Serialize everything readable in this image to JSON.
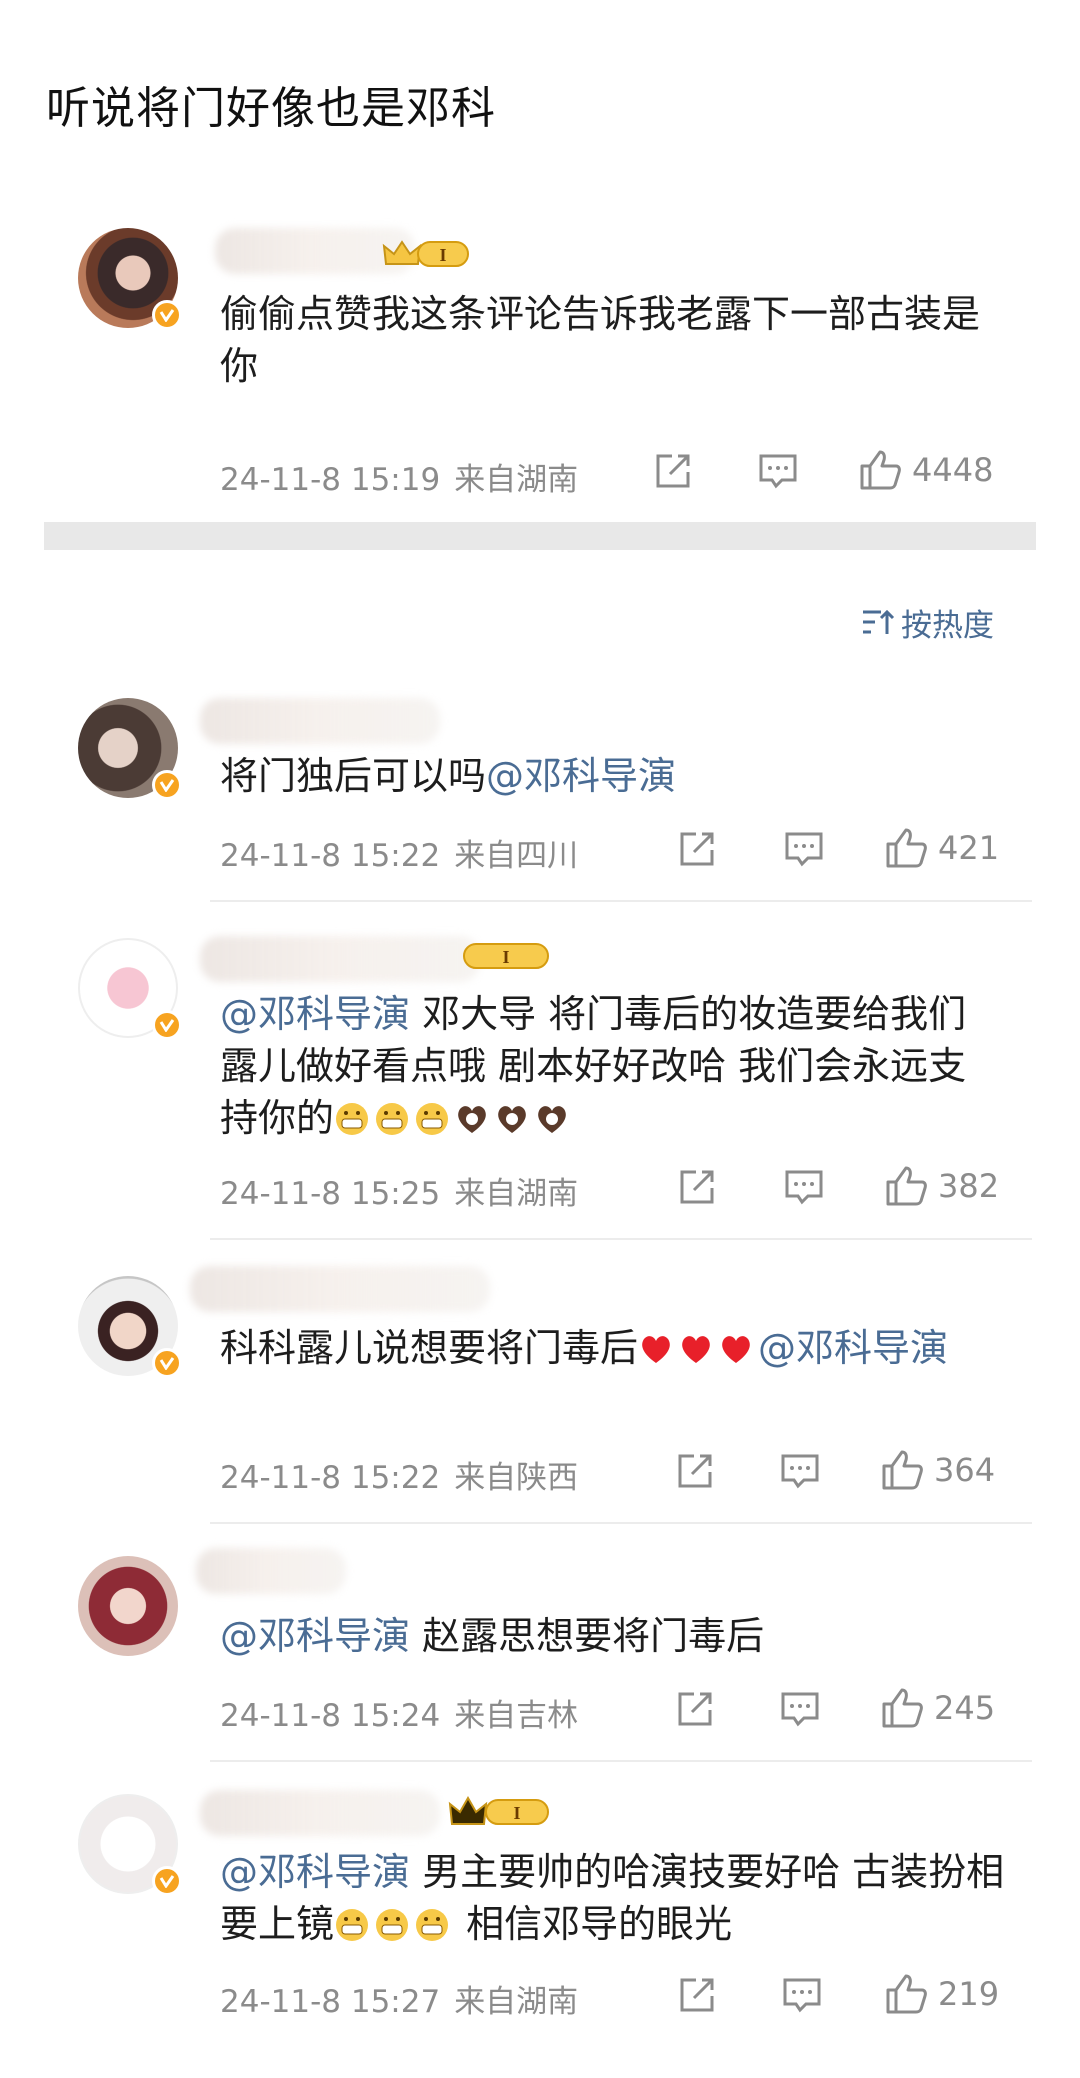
{
  "page": {
    "title": "听说将门好像也是邓科"
  },
  "sort": {
    "label": "按热度"
  },
  "top_comment": {
    "text": "偷偷点赞我这条评论告诉我老露下一部古装是你",
    "time": "24-11-8 15:19",
    "location": "来自湖南",
    "likes": "4448"
  },
  "replies": [
    {
      "pre": "将门独后可以吗",
      "mention": "@邓科导演",
      "post": "",
      "time": "24-11-8 15:22",
      "location": "来自四川",
      "likes": "421"
    },
    {
      "mention": "@邓科导演",
      "text": " 邓大导  将门毒后的妆造要给我们露儿做好看点哦  剧本好好改哈 我们会永远支持你的",
      "time": "24-11-8 15:25",
      "location": "来自湖南",
      "likes": "382"
    },
    {
      "pre": "科科露儿说想要将门毒后",
      "mention": "@邓科导演",
      "time": "24-11-8 15:22",
      "location": "来自陕西",
      "likes": "364"
    },
    {
      "mention": "@邓科导演",
      "text": " 赵露思想要将门毒后",
      "time": "24-11-8 15:24",
      "location": "来自吉林",
      "likes": "245"
    },
    {
      "mention": "@邓科导演",
      "text": " 男主要帅的哈演技要好哈 古装扮相要上镜",
      "text2": " 相信邓导的眼光",
      "time": "24-11-8 15:27",
      "location": "来自湖南",
      "likes": "219"
    }
  ],
  "badges": {
    "vip_level": "I"
  },
  "colors": {
    "mention": "#4a6c94",
    "meta": "#8b8b8b",
    "verified": "#f7a320",
    "heart": "#e8202a"
  },
  "icons": [
    "share-icon",
    "comment-icon",
    "like-icon",
    "sort-icon",
    "verified-badge-icon",
    "vip-crown-icon"
  ]
}
